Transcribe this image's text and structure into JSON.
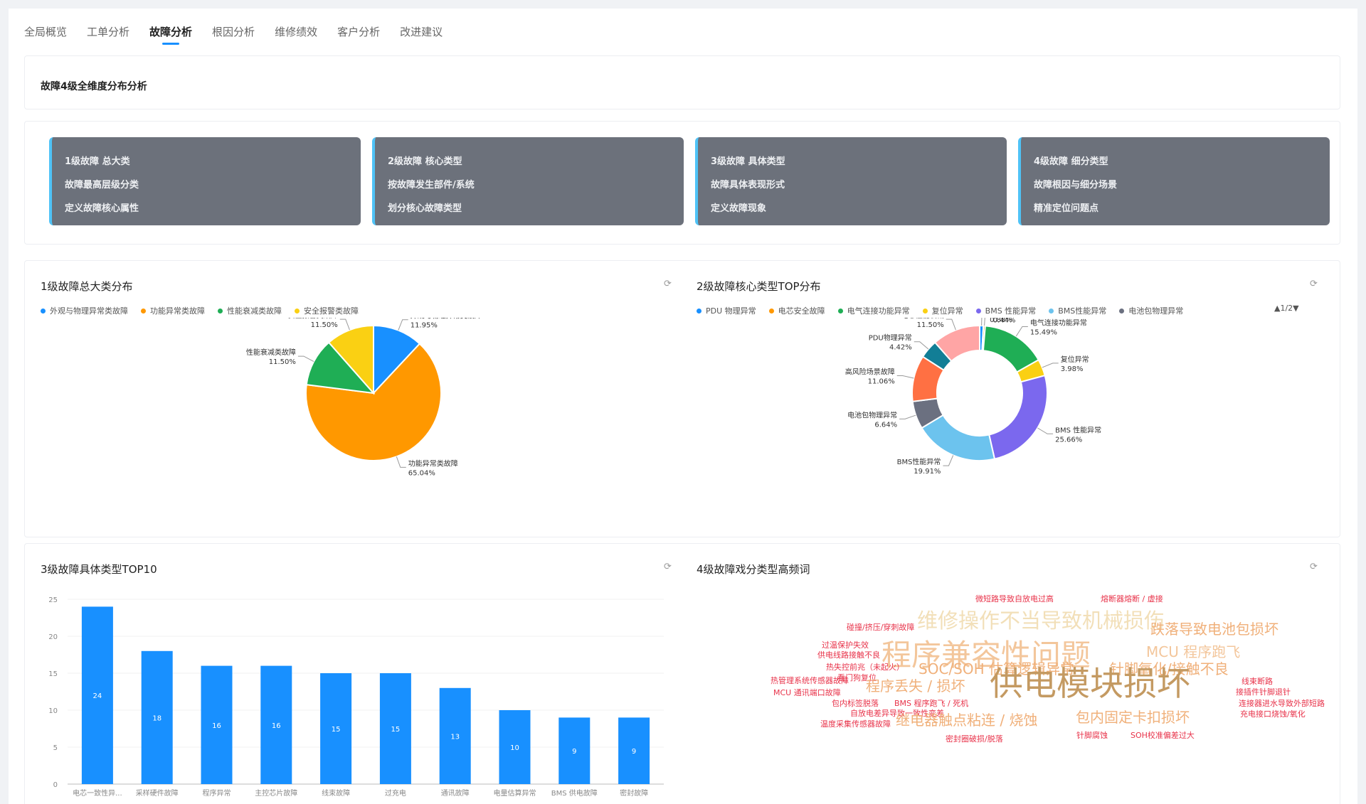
{
  "tabs": [
    "全局概览",
    "工单分析",
    "故障分析",
    "根因分析",
    "维修绩效",
    "客户分析",
    "改进建议"
  ],
  "active_tab": "故障分析",
  "section_title": "故障4级全维度分布分析",
  "levels": [
    {
      "title": "1级故障 总大类",
      "line2": "故障最高层级分类",
      "line3": "定义故障核心属性"
    },
    {
      "title": "2级故障 核心类型",
      "line2": "按故障发生部件/系统",
      "line3": "划分核心故障类型"
    },
    {
      "title": "3级故障 具体类型",
      "line2": "故障具体表现形式",
      "line3": "定义故障现象"
    },
    {
      "title": "4级故障 细分类型",
      "line2": "故障根因与细分场景",
      "line3": "精准定位问题点"
    }
  ],
  "chart1": {
    "title": "1级故障总大类分布",
    "colors": [
      "#1890ff",
      "#ff9800",
      "#1fae55",
      "#fad013"
    ],
    "chart_data": {
      "type": "pie",
      "categories": [
        "外观与物理异常类故障",
        "功能异常类故障",
        "性能衰减类故障",
        "安全报警类故障"
      ],
      "values": [
        11.95,
        65.04,
        11.5,
        11.5
      ],
      "labels": [
        "11.95%",
        "65.04%",
        "11.50%",
        "11.50%"
      ]
    }
  },
  "chart2": {
    "title": "2级故障核心类型TOP分布",
    "pager": "▲1/2▼",
    "legend": [
      "PDU 物理异常",
      "电芯安全故障",
      "电气连接功能异常",
      "复位异常",
      "BMS 性能异常",
      "BMS性能异常",
      "电池包物理异常"
    ],
    "colors": [
      "#1890ff",
      "#ff9800",
      "#1fae55",
      "#fad013",
      "#7b68ee",
      "#6cc3ee",
      "#6b7080",
      "#ff7043",
      "#127e96",
      "#ffa5a5"
    ],
    "chart_data": {
      "type": "pie",
      "categories": [
        "PDU 物理异常",
        "电芯安全故障",
        "电气连接功能异常",
        "复位异常",
        "BMS 性能异常",
        "BMS性能异常",
        "电池包物理异常",
        "高风险场景故障",
        "PDU物理异常",
        "电芯性能衰减"
      ],
      "values": [
        0.88,
        0.44,
        15.49,
        3.98,
        25.66,
        19.91,
        6.64,
        11.06,
        4.42,
        11.5
      ],
      "labels": [
        "0.88%",
        "0.44%",
        "15.49%",
        "3.98%",
        "25.66%",
        "19.91%",
        "6.64%",
        "11.06%",
        "4.42%",
        "11.50%"
      ]
    }
  },
  "chart3": {
    "title": "3级故障具体类型TOP10",
    "chart_data": {
      "type": "bar",
      "categories": [
        "电芯一致性异...",
        "采样硬件故障",
        "程序异常",
        "主控芯片故障",
        "线束故障",
        "过充电",
        "通讯故障",
        "电量估算异常",
        "BMS 供电故障",
        "密封故障"
      ],
      "values": [
        24,
        18,
        16,
        16,
        15,
        15,
        13,
        10,
        9,
        9
      ],
      "ylim": [
        0,
        25
      ],
      "yticks": [
        "0",
        "5",
        "10",
        "15",
        "20",
        "25"
      ]
    }
  },
  "chart4": {
    "title": "4级故障戏分类型高频词",
    "words": [
      {
        "text": "微短路导致自放电过高",
        "color": "#e8334a"
      },
      {
        "text": "熔断器熔断 / 虚接",
        "color": "#e8334a"
      },
      {
        "text": "维修操作不当导致机械损伤",
        "color": "#f2dfb8"
      },
      {
        "text": "碰撞/挤压/穿刺故障",
        "color": "#e8334a"
      },
      {
        "text": "跌落导致电池包损坏",
        "color": "#f0b07a"
      },
      {
        "text": "程序兼容性问题",
        "color": "#f3c69b"
      },
      {
        "text": "过温保护失效",
        "color": "#e8334a"
      },
      {
        "text": "供电线路接触不良",
        "color": "#e8334a"
      },
      {
        "text": "MCU 程序跑飞",
        "color": "#f3c69b"
      },
      {
        "text": "热失控前兆（未起火）",
        "color": "#e8334a"
      },
      {
        "text": "看门狗复位",
        "color": "#e8334a"
      },
      {
        "text": "SOC/SOH 估算逻辑异常",
        "color": "#f0b07a"
      },
      {
        "text": "针脚氧化/接触不良",
        "color": "#f0b07a"
      },
      {
        "text": "热管理系统传感器故障",
        "color": "#e8334a"
      },
      {
        "text": "线束断路",
        "color": "#e8334a"
      },
      {
        "text": "MCU 通讯端口故障",
        "color": "#e8334a"
      },
      {
        "text": "程序丢失 / 损坏",
        "color": "#f0b07a"
      },
      {
        "text": "供电模块损坏",
        "color": "#c49a62"
      },
      {
        "text": "接插件针脚退针",
        "color": "#e8334a"
      },
      {
        "text": "包内标签脱落",
        "color": "#e8334a"
      },
      {
        "text": "BMS 程序跑飞 / 死机",
        "color": "#e8334a"
      },
      {
        "text": "连接器进水导致外部短路",
        "color": "#e8334a"
      },
      {
        "text": "自放电差异导致一致性变差",
        "color": "#e8334a"
      },
      {
        "text": "充电接口烧蚀/氧化",
        "color": "#e8334a"
      },
      {
        "text": "温度采集传感器故障",
        "color": "#e8334a"
      },
      {
        "text": "继电器触点粘连 / 烧蚀",
        "color": "#f0b07a"
      },
      {
        "text": "包内固定卡扣损坏",
        "color": "#f0b07a"
      },
      {
        "text": "针脚腐蚀",
        "color": "#e8334a"
      },
      {
        "text": "SOH校准偏差过大",
        "color": "#e8334a"
      },
      {
        "text": "密封圈破损/脱落",
        "color": "#e8334a"
      }
    ]
  }
}
